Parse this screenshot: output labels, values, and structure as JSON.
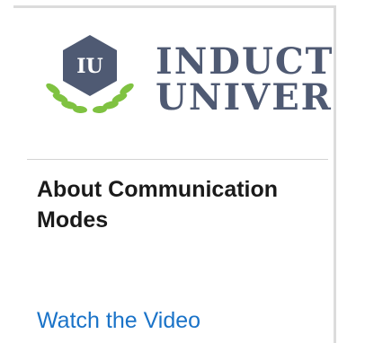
{
  "logo": {
    "monogram": "IU",
    "icon": "inductive-university-logo-icon",
    "colors": {
      "hexagon": "#4f5a73",
      "laurel": "#7fc241",
      "monogram": "#ffffff"
    }
  },
  "brand": {
    "line1": "INDUCTIVE",
    "line2": "UNIVERSITY",
    "color": "#4f5a73"
  },
  "content": {
    "title": "About Communication Modes",
    "link_label": "Watch the Video",
    "link_color": "#1a73c8"
  }
}
